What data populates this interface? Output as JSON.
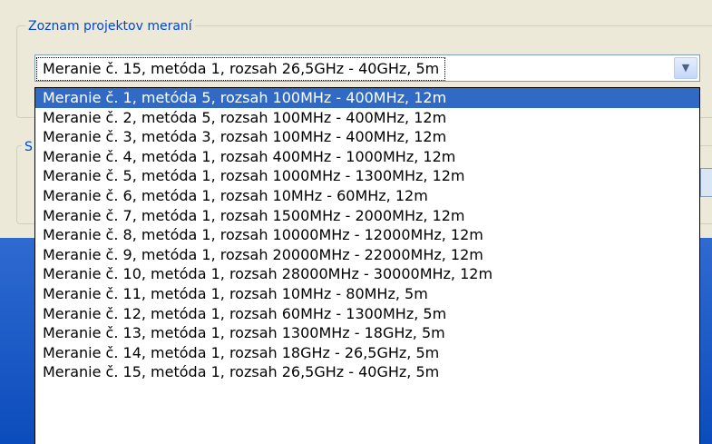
{
  "group_projects": {
    "title": "Zoznam projektov meraní"
  },
  "group_second": {
    "title": "S"
  },
  "combo": {
    "selected": "Meranie č. 15, metóda 1, rozsah 26,5GHz - 40GHz, 5m",
    "arrow_icon": "chevron-down-icon"
  },
  "dropdown": {
    "selected_index": 0,
    "items": [
      "Meranie č. 1, metóda 5, rozsah 100MHz - 400MHz, 12m",
      "Meranie č. 2, metóda 5, rozsah 100MHz - 400MHz, 12m",
      "Meranie č. 3, metóda 3, rozsah 100MHz - 400MHz, 12m",
      "Meranie č. 4, metóda 1, rozsah 400MHz - 1000MHz, 12m",
      "Meranie č. 5, metóda 1, rozsah 1000MHz - 1300MHz, 12m",
      "Meranie č. 6, metóda 1, rozsah 10MHz - 60MHz, 12m",
      "Meranie č. 7, metóda 1, rozsah 1500MHz - 2000MHz, 12m",
      "Meranie č. 8, metóda 1, rozsah 10000MHz - 12000MHz, 12m",
      "Meranie č. 9, metóda 1, rozsah 20000MHz - 22000MHz, 12m",
      "Meranie č. 10, metóda 1, rozsah 28000MHz - 30000MHz, 12m",
      "Meranie č. 11, metóda 1, rozsah 10MHz - 80MHz, 5m",
      "Meranie č. 12, metóda 1, rozsah 60MHz - 1300MHz, 5m",
      "Meranie č. 13, metóda 1, rozsah 1300MHz - 18GHz, 5m",
      "Meranie č. 14, metóda 1, rozsah 18GHz - 26,5GHz, 5m",
      "Meranie č. 15, metóda 1, rozsah 26,5GHz - 40GHz, 5m"
    ]
  },
  "colors": {
    "selection": "#316ac5",
    "group_title": "#0046d5",
    "window_bg": "#ece9d8",
    "desktop_blue": "#0b4cbc"
  }
}
